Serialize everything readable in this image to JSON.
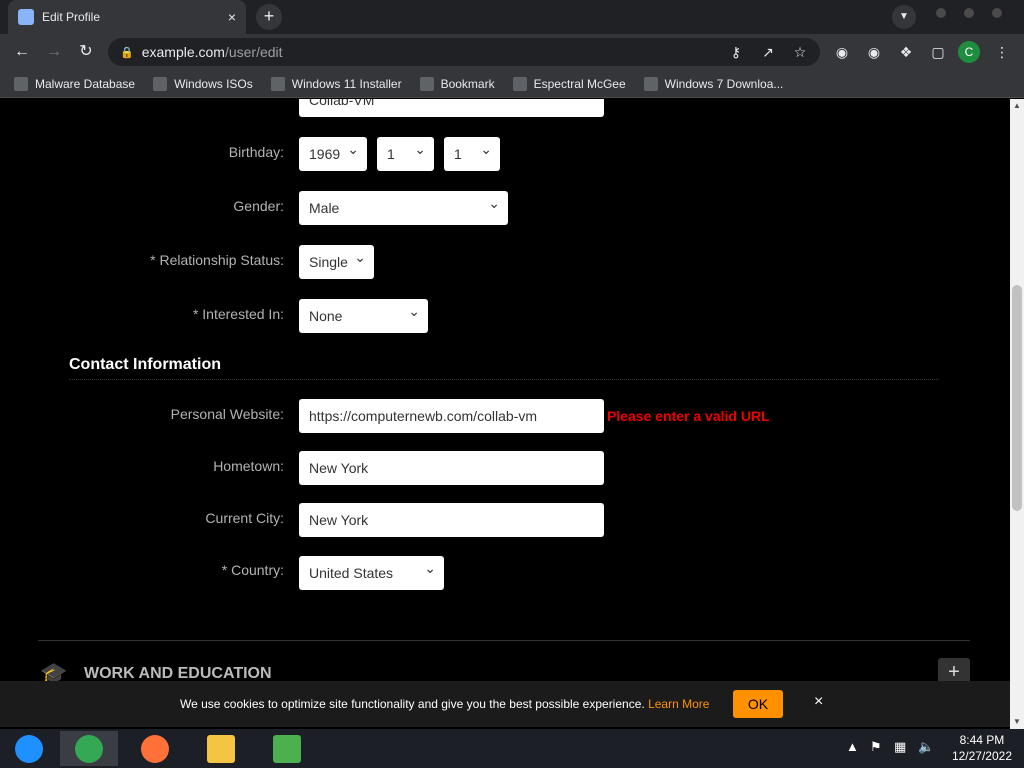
{
  "browser": {
    "tab_title": "Edit Profile",
    "tab_close": "×",
    "new_tab": "+",
    "url_host": "example.com",
    "url_path": "/user/edit",
    "profile_initial": "C"
  },
  "bookmarks": [
    {
      "label": "Malware Database"
    },
    {
      "label": "Windows ISOs"
    },
    {
      "label": "Windows 11 Installer"
    },
    {
      "label": "Bookmark"
    },
    {
      "label": "Espectral McGee"
    },
    {
      "label": "Windows 7 Downloa..."
    }
  ],
  "profile_form": {
    "name_value": "Collab-VM",
    "birthday_label": "Birthday:",
    "birthday_year": "1969",
    "birthday_month": "1",
    "birthday_day": "1",
    "gender_label": "Gender:",
    "gender_value": "Male",
    "relationship_label": "* Relationship Status:",
    "relationship_value": "Single",
    "interested_label": "* Interested In:",
    "interested_value": "None"
  },
  "contact": {
    "section_title": "Contact Information",
    "website_label": "Personal Website:",
    "website_value": "https://computernewb.com/collab-vm",
    "website_error": "Please enter a valid URL",
    "hometown_label": "Hometown:",
    "hometown_value": "New York",
    "city_label": "Current City:",
    "city_value": "New York",
    "country_label": "* Country:",
    "country_value": "United States"
  },
  "work_education": {
    "title": "WORK AND EDUCATION",
    "expand": "+"
  },
  "cookie_banner": {
    "message": "We use cookies to optimize site functionality and give you the best possible experience.",
    "learn_more": "Learn More",
    "ok": "OK",
    "close": "×"
  },
  "clock": {
    "time": "8:44 PM",
    "date": "12/27/2022"
  }
}
